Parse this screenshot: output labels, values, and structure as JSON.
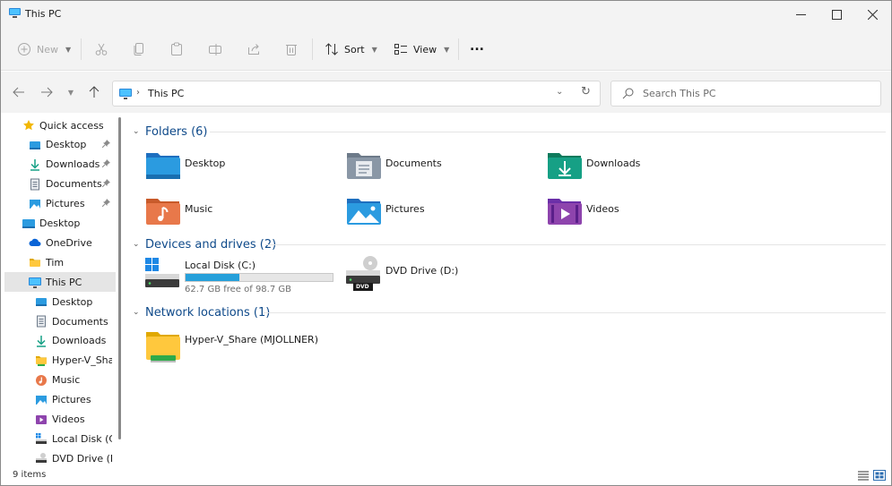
{
  "window": {
    "title": "This PC"
  },
  "toolbar": {
    "new_label": "New",
    "sort_label": "Sort",
    "view_label": "View",
    "more_label": "..."
  },
  "address": {
    "breadcrumb": "This PC"
  },
  "search": {
    "placeholder": "Search This PC"
  },
  "sidebar": {
    "items": [
      {
        "label": "Quick access",
        "icon": "star-icon",
        "level": 0,
        "pinned": false
      },
      {
        "label": "Desktop",
        "icon": "desktop-folder-icon",
        "level": 1,
        "pinned": true
      },
      {
        "label": "Downloads",
        "icon": "download-icon",
        "level": 1,
        "pinned": true
      },
      {
        "label": "Documents",
        "icon": "document-icon",
        "level": 1,
        "pinned": true
      },
      {
        "label": "Pictures",
        "icon": "pictures-icon",
        "level": 1,
        "pinned": true
      },
      {
        "label": "Desktop",
        "icon": "desktop-icon",
        "level": 0,
        "pinned": false
      },
      {
        "label": "OneDrive",
        "icon": "cloud-icon",
        "level": 1,
        "pinned": false
      },
      {
        "label": "Tim",
        "icon": "folder-icon",
        "level": 1,
        "pinned": false
      },
      {
        "label": "This PC",
        "icon": "computer-icon",
        "level": 1,
        "pinned": false,
        "selected": true
      },
      {
        "label": "Desktop",
        "icon": "desktop-folder-icon",
        "level": 2,
        "pinned": false
      },
      {
        "label": "Documents",
        "icon": "document-icon",
        "level": 2,
        "pinned": false
      },
      {
        "label": "Downloads",
        "icon": "download-icon",
        "level": 2,
        "pinned": false
      },
      {
        "label": "Hyper-V_Share",
        "icon": "network-folder-icon",
        "level": 2,
        "pinned": false
      },
      {
        "label": "Music",
        "icon": "music-icon",
        "level": 2,
        "pinned": false
      },
      {
        "label": "Pictures",
        "icon": "pictures-icon",
        "level": 2,
        "pinned": false
      },
      {
        "label": "Videos",
        "icon": "video-icon",
        "level": 2,
        "pinned": false
      },
      {
        "label": "Local Disk (C:)",
        "icon": "disk-icon",
        "level": 2,
        "pinned": false
      },
      {
        "label": "DVD Drive (D:)",
        "icon": "dvd-icon",
        "level": 2,
        "pinned": false
      }
    ]
  },
  "groups": {
    "folders": {
      "header": "Folders (6)",
      "items": [
        {
          "name": "Desktop",
          "icon": "desktop-folder-icon"
        },
        {
          "name": "Documents",
          "icon": "documents-folder-icon"
        },
        {
          "name": "Downloads",
          "icon": "downloads-folder-icon"
        },
        {
          "name": "Music",
          "icon": "music-folder-icon"
        },
        {
          "name": "Pictures",
          "icon": "pictures-folder-icon"
        },
        {
          "name": "Videos",
          "icon": "videos-folder-icon"
        }
      ]
    },
    "devices": {
      "header": "Devices and drives (2)",
      "items": [
        {
          "name": "Local Disk (C:)",
          "icon": "windows-disk-icon",
          "free_text": "62.7 GB free of 98.7 GB",
          "used_fraction": 0.365
        },
        {
          "name": "DVD Drive (D:)",
          "icon": "dvd-drive-icon",
          "badge": "DVD"
        }
      ]
    },
    "network": {
      "header": "Network locations (1)",
      "items": [
        {
          "name": "Hyper-V_Share (MJOLLNER)",
          "icon": "network-share-icon"
        }
      ]
    }
  },
  "status": {
    "item_count": "9 items"
  },
  "colors": {
    "accent": "#0f4a8a",
    "drive_fill": "#26a0da",
    "selected_bg": "#e5e5e5"
  }
}
